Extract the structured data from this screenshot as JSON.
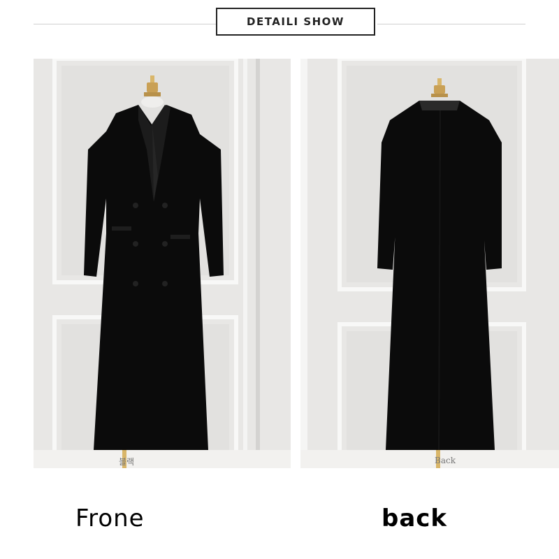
{
  "header": {
    "title": "DETAILI SHOW"
  },
  "photos": {
    "front": {
      "tag": "블랙"
    },
    "back": {
      "tag": "Back"
    }
  },
  "captions": {
    "front": "Frone",
    "back": "back"
  },
  "colors": {
    "wall": "#ecebe9",
    "panel_frame": "#f7f7f6",
    "coat": "#0b0b0b",
    "lapel": "#1c1c1c",
    "mannequin": "#caa15a"
  }
}
